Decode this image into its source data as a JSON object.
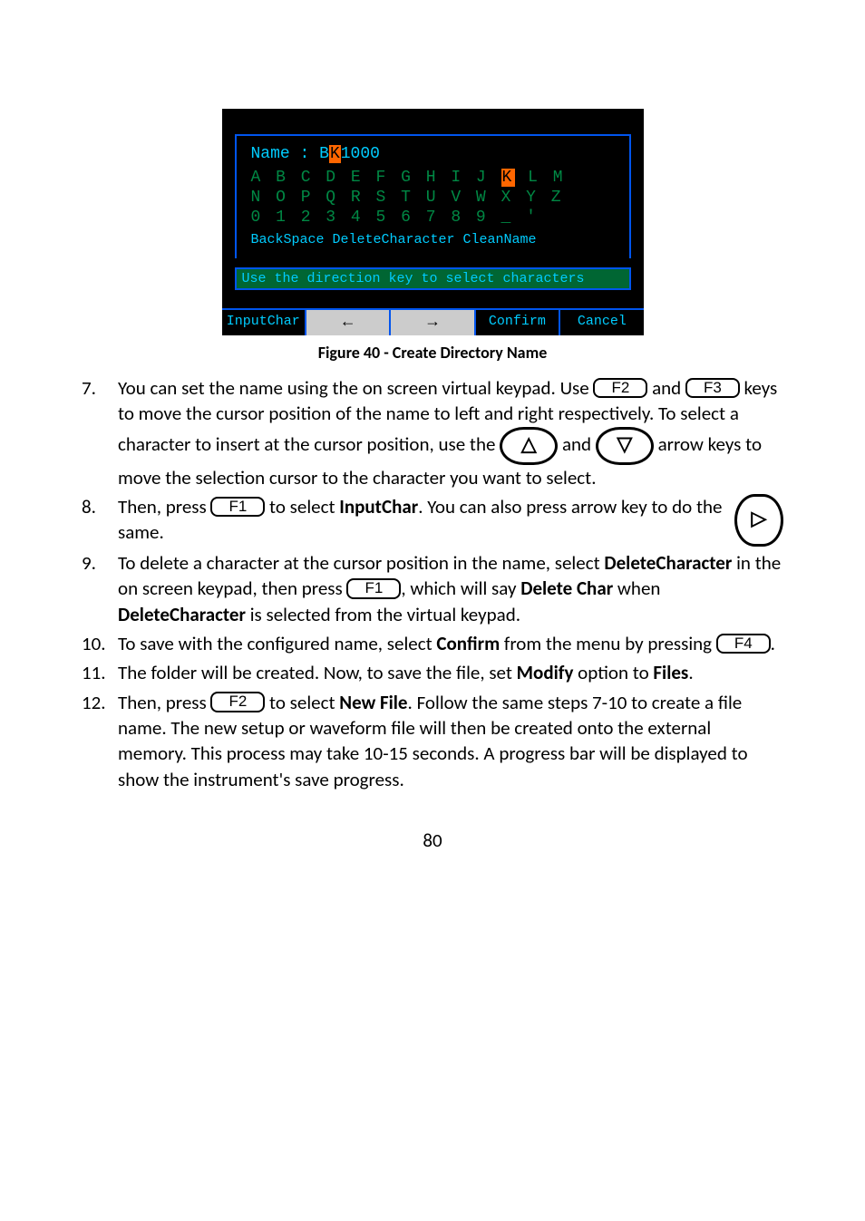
{
  "dialog": {
    "name_label": "Name :",
    "name_value_pre": "B",
    "name_value_cursor": "K",
    "name_value_post": "1000",
    "row1_pre": "A B C D E F G H I J ",
    "row1_sel": "K",
    "row1_post": " L M",
    "row2": "N O P Q R S T U V W X Y Z",
    "row3": "0 1 2 3 4 5 6 7 8 9 _ '",
    "func_row": "BackSpace    DeleteCharacter   CleanName",
    "hint": "Use the direction key to select characters",
    "soft1": "InputChar",
    "soft_left": "←",
    "soft_right": "→",
    "soft4": "Confirm",
    "soft5": "Cancel"
  },
  "caption": "Figure 40 - Create Directory Name",
  "steps": {
    "s7a": "You can set the name using the on screen virtual keypad.  Use ",
    "s7b": " and ",
    "s7c": " keys to move the cursor position of the name to left and right respectively.  To select a character to insert at the cursor position, use the ",
    "s7d": " and ",
    "s7e": " arrow keys to move the selection cursor to the character you want to select.",
    "s8a": "Then, press ",
    "s8b": " to select ",
    "s8bold": "InputChar",
    "s8c": ".  You can also press arrow key to do the same.",
    "s9a": "To delete a character at the cursor position in the name, select ",
    "s9bold1": "DeleteCharacter",
    "s9b": " in the on screen keypad, then press ",
    "s9c": ", which will say ",
    "s9bold2": "Delete Char",
    "s9d": " when ",
    "s9bold3": "DeleteCharacter",
    "s9e": " is selected from the virtual keypad.",
    "s10a": "To save with the configured name, select ",
    "s10bold": "Confirm",
    "s10b": " from the menu by pressing ",
    "s10c": ".",
    "s11a": "The folder will be created.  Now, to save the file, set ",
    "s11bold1": "Modify",
    "s11b": " option to ",
    "s11bold2": "Files",
    "s11c": ".",
    "s12a": "Then, press ",
    "s12b": " to select ",
    "s12bold": "New File",
    "s12c": ".  Follow the same steps 7-10 to create a file name.  The new setup or waveform file will then be created onto the external memory.  This process may take 10-15 seconds.  A progress bar will be displayed to show the instrument's save progress."
  },
  "keys": {
    "F1": "F1",
    "F2": "F2",
    "F3": "F3",
    "F4": "F4",
    "up": "△",
    "down": "▽",
    "right": "▷"
  },
  "pagenum": "80"
}
